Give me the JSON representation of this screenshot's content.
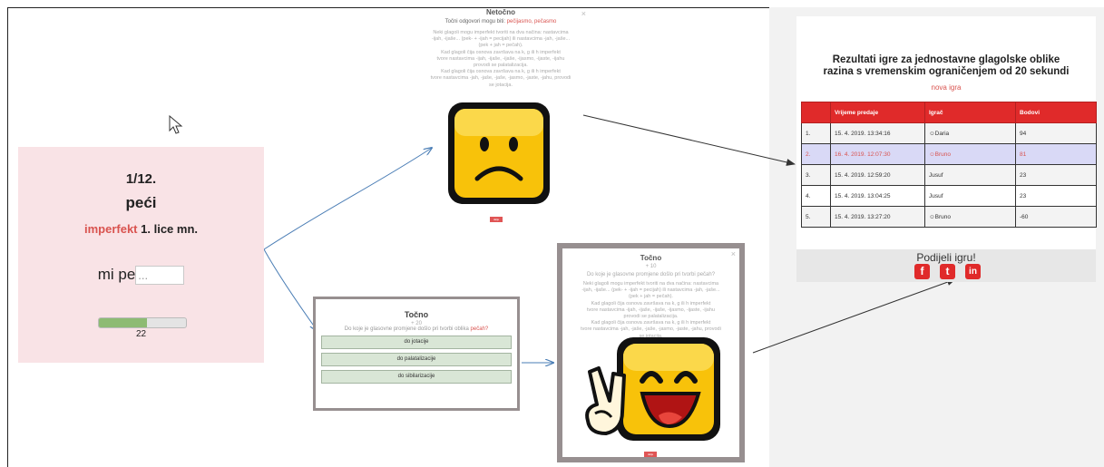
{
  "question": {
    "counter": "1/12.",
    "verb": "peći",
    "tense": "imperfekt",
    "person": "1. lice mn.",
    "prompt": "mi pe",
    "input_value": "...",
    "progress": 0.55,
    "timer": "22"
  },
  "wrong_dialog": {
    "title": "Netočno",
    "answers_intro": "Točni odgovori mogu biti:",
    "answers": "pečijasmo, pečasmo",
    "explanation": [
      "Neki glagoli mogu imperfekt tvoriti na dva načina: nastavcima",
      "-ijah, -ijaše... (pek- + -ijah = pecijah) ili nastavcima -jah, -jaše...",
      "(pek + jah = pečah).",
      "Kad glagoli čija osnova završava na k, g ili h imperfekt",
      "tvore nastavcima -ijah, -ijaše, -ijaše, -ijasmo, -ijaste, -ijahu",
      "provodi se palatalizacija.",
      "Kad glagoli čija osnova završava na k, g ili h imperfekt",
      "tvore nastavcima -jah, -jaše, -jaše, -jasmo, -jaste, -jahu, provodi",
      "se jotacija."
    ],
    "button": "dalje"
  },
  "quiz_dialog": {
    "title": "Točno",
    "points": "+ 20",
    "question_prefix": "Do koje je glasovne promjene došlo pri tvorbi oblika",
    "question_word": "pečah?",
    "options": [
      "do jotacije",
      "do palatalizacije",
      "do sibilarizacije"
    ]
  },
  "correct_dialog": {
    "title": "Točno",
    "points": "+ 10",
    "question": "Do koje je glasovne promjene došlo pri tvorbi pečah?",
    "explanation": [
      "Neki glagoli mogu imperfekt tvoriti na dva načina: nastavcima",
      "-ijah, -ijaše... (pek- + -ijah = pecijah) ili nastavcima -jah, -jaše...",
      "(pek + jah = pečah).",
      "Kad glagoli čija osnova završava na k, g ili h imperfekt",
      "tvore nastavcima -ijah, -ijaše, -ijaše, -ijasmo, -ijaste, -ijahu",
      "provodi se palatalizacija.",
      "Kad glagoli čija osnova završava na k, g ili h imperfekt",
      "tvore nastavcima -jah, -jaše, -jaše, -jasmo, -jaste, -jahu, provodi",
      "se jotacija."
    ],
    "button": "dalje"
  },
  "results": {
    "title_line1": "Rezultati igre za jednostavne glagolske oblike",
    "title_line2": "razina s vremenskim ograničenjem od 20 sekundi",
    "new_game": "nova igra",
    "headers": [
      "",
      "Vrijeme predaje",
      "Igrač",
      "Bodovi"
    ],
    "rows": [
      [
        "1.",
        "15. 4. 2019. 13:34:16",
        "☺Daria",
        "94"
      ],
      [
        "2.",
        "16. 4. 2019. 12:07:30",
        "☺Bruno",
        "81"
      ],
      [
        "3.",
        "15. 4. 2019. 12:59:20",
        "Jusuf",
        "23"
      ],
      [
        "4.",
        "15. 4. 2019. 13:04:25",
        "Jusuf",
        "23"
      ],
      [
        "5.",
        "15. 4. 2019. 13:27:20",
        "☺Bruno",
        "-60"
      ]
    ],
    "highlight_row": 1,
    "share_label": "Podijeli igru!",
    "social": [
      "f",
      "t",
      "in"
    ]
  },
  "colors": {
    "accent_red": "#e02a2a",
    "card_pink": "#f9e3e6",
    "arrow_blue": "#4a7db5",
    "arrow_dark": "#333333"
  }
}
